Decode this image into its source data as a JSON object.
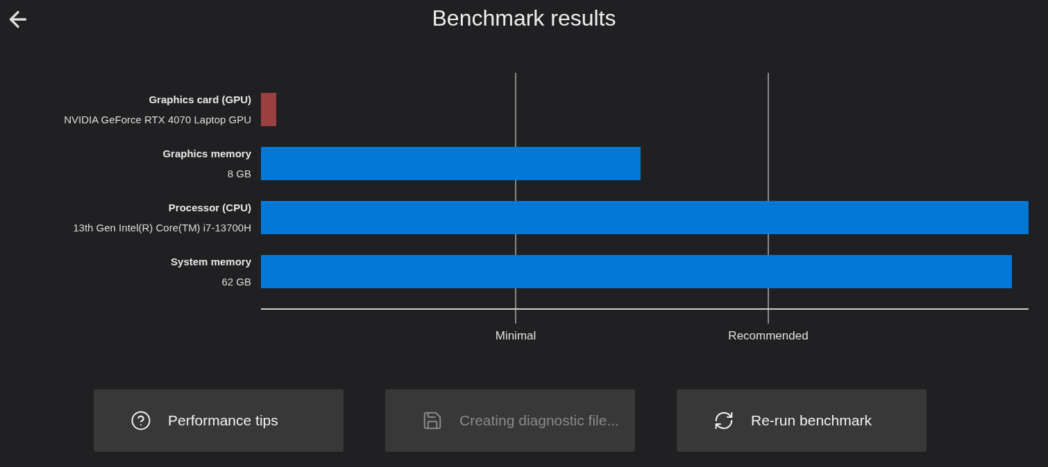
{
  "header": {
    "title": "Benchmark results"
  },
  "results": {
    "components": [
      {
        "name": "Graphics card (GPU)",
        "detail": "NVIDIA GeForce RTX 4070 Laptop GPU",
        "level": 0.02,
        "color": "#9b4040"
      },
      {
        "name": "Graphics memory",
        "detail": "8 GB",
        "level": 0.495,
        "color": "#0078d4"
      },
      {
        "name": "Processor (CPU)",
        "detail": "13th Gen Intel(R) Core(TM) i7-13700H",
        "level": 1.0,
        "color": "#0078d4"
      },
      {
        "name": "System memory",
        "detail": "62 GB",
        "level": 0.978,
        "color": "#0078d4"
      }
    ],
    "scale_labels": [
      "Minimal",
      "Recommended"
    ]
  },
  "buttons": [
    {
      "kind": "help",
      "label": "Performance tips",
      "disabled": false
    },
    {
      "kind": "save",
      "label": "Creating diagnostic file...",
      "disabled": true
    },
    {
      "kind": "refresh",
      "label": "Re-run benchmark",
      "disabled": false
    }
  ]
}
